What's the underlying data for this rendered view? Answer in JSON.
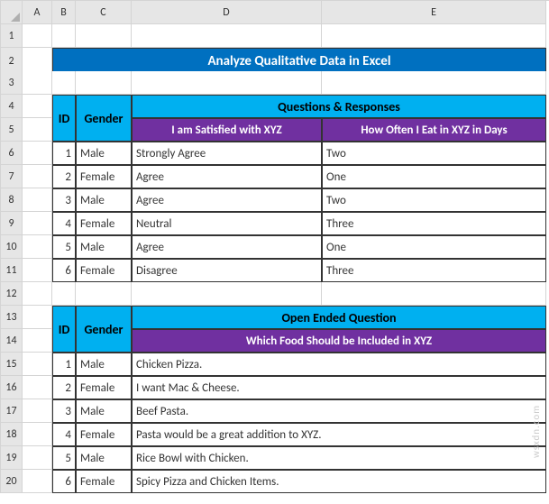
{
  "columns": [
    "A",
    "B",
    "C",
    "D",
    "E"
  ],
  "rows": [
    "1",
    "2",
    "3",
    "4",
    "5",
    "6",
    "7",
    "8",
    "9",
    "10",
    "11",
    "12",
    "13",
    "14",
    "15",
    "16",
    "17",
    "18",
    "19",
    "20"
  ],
  "title": "Analyze Qualitative Data in Excel",
  "table1": {
    "id_hdr": "ID",
    "gender_hdr": "Gender",
    "group_hdr": "Questions & Responses",
    "q1": "I am Satisfied with XYZ",
    "q2": "How Often I Eat in XYZ in Days",
    "rows": [
      {
        "id": "1",
        "gender": "Male",
        "a1": "Strongly Agree",
        "a2": "Two"
      },
      {
        "id": "2",
        "gender": "Female",
        "a1": "Agree",
        "a2": "One"
      },
      {
        "id": "3",
        "gender": "Male",
        "a1": "Agree",
        "a2": "Two"
      },
      {
        "id": "4",
        "gender": "Female",
        "a1": "Neutral",
        "a2": "Three"
      },
      {
        "id": "5",
        "gender": "Male",
        "a1": "Agree",
        "a2": "One"
      },
      {
        "id": "6",
        "gender": "Female",
        "a1": "Disagree",
        "a2": "Three"
      }
    ]
  },
  "table2": {
    "id_hdr": "ID",
    "gender_hdr": "Gender",
    "group_hdr": "Open Ended Question",
    "q1": "Which Food Should be Included in XYZ",
    "rows": [
      {
        "id": "1",
        "gender": "Male",
        "a1": "Chicken Pizza."
      },
      {
        "id": "2",
        "gender": "Female",
        "a1": "I want Mac & Cheese."
      },
      {
        "id": "3",
        "gender": "Male",
        "a1": "Beef Pasta."
      },
      {
        "id": "4",
        "gender": "Female",
        "a1": "Pasta would be a great addition to XYZ."
      },
      {
        "id": "5",
        "gender": "Male",
        "a1": "Rice Bowl with Chicken."
      },
      {
        "id": "6",
        "gender": "Female",
        "a1": "Spicy Pizza and Chicken Items."
      }
    ]
  },
  "watermark": "wsxdn.com"
}
